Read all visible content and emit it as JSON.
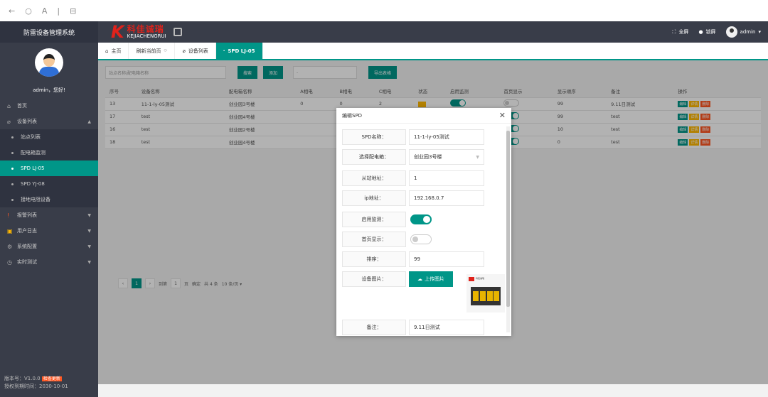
{
  "browser": {
    "back": "←",
    "reload": "○",
    "font": "A",
    "divider": "|",
    "tabs": "⊟"
  },
  "header": {
    "app_title": "防雷设备管理系统",
    "logo_cn": "科佳诚瑞",
    "logo_en": "KEJIACHENGRUI",
    "fullscreen": "全屏",
    "lock": "锁屏",
    "user": "admin"
  },
  "sidebar": {
    "greeting": "admin，您好!",
    "menu": [
      {
        "label": "首页",
        "icon": "⌂"
      },
      {
        "label": "设备列表",
        "icon": "⌀",
        "caret": "▲"
      }
    ],
    "submenu": [
      "站点列表",
      "配电箱监测",
      "SPD LJ-05",
      "SPD YJ-08",
      "接地电阻设备"
    ],
    "menu2": [
      {
        "label": "报警列表",
        "icon": "!",
        "caret": "▼"
      },
      {
        "label": "用户日志",
        "icon": "▣",
        "caret": "▼"
      },
      {
        "label": "系统配置",
        "icon": "⚙",
        "caret": "▼"
      },
      {
        "label": "实时测试",
        "icon": "◷",
        "caret": "▼"
      }
    ],
    "version_label": "版本号：V1.0.0",
    "check_update": "检查更新",
    "auth_expiry": "授权到期时间：2030-10-01"
  },
  "tabs": [
    {
      "label": "主页"
    },
    {
      "label": "刷新当前页"
    },
    {
      "label": "设备列表"
    },
    {
      "label": "SPD LJ-05",
      "active": true
    }
  ],
  "toolbar": {
    "search_placeholder": "站点名称/配电箱名称",
    "search_btn": "搜索",
    "add_btn": "添加",
    "select_placeholder": "-",
    "export_btn": "导出表格"
  },
  "table": {
    "headers": [
      "序号",
      "设备名称",
      "配电箱名称",
      "A相电",
      "B相电",
      "C相电",
      "状态",
      "启用监测",
      "首页显示",
      "显示顺序",
      "备注",
      "操作"
    ],
    "rows": [
      [
        "13",
        "11-1-ly-05测试",
        "创业园3号楼",
        "0",
        "0",
        "2",
        "",
        "on",
        "off",
        "99",
        "9.11日测试"
      ],
      [
        "17",
        "test",
        "创业园4号楼",
        "",
        "",
        "",
        "",
        "on",
        "on",
        "99",
        "test"
      ],
      [
        "16",
        "test",
        "创业园2号楼",
        "",
        "",
        "",
        "",
        "on",
        "on",
        "10",
        "test"
      ],
      [
        "18",
        "test",
        "创业园4号楼",
        "",
        "",
        "",
        "",
        "on",
        "on",
        "0",
        "test"
      ]
    ],
    "ops": [
      "编辑",
      "详情",
      "删除"
    ]
  },
  "pager": {
    "current": "1",
    "goto_label": "到第",
    "goto_value": "1",
    "page_unit": "页",
    "confirm": "确定",
    "total": "共 4 条",
    "per_page": "10 条/页 ▾"
  },
  "modal": {
    "title": "编辑SPD",
    "close": "✕",
    "fields": [
      {
        "label": "SPD名称：",
        "value": "11-1-ly-05测试"
      },
      {
        "label": "选择配电箱：",
        "value": "创业园3号楼",
        "select": true
      },
      {
        "label": "从站地址：",
        "value": "1"
      },
      {
        "label": "ip地址：",
        "value": "192.168.0.7"
      },
      {
        "label": "启用监测：",
        "switch": "on"
      },
      {
        "label": "首页显示：",
        "switch": "off"
      },
      {
        "label": "排序：",
        "value": "99"
      },
      {
        "label": "设备图片：",
        "upload": "上传图片"
      },
      {
        "label": "备注：",
        "value": "9.11日测试"
      }
    ],
    "thumb_brand": "科佳诚瑞"
  },
  "colors": {
    "teal": "#009688",
    "dark": "#393d49",
    "red": "#e0221b",
    "orange": "#ffb800",
    "danger": "#ff5722"
  }
}
